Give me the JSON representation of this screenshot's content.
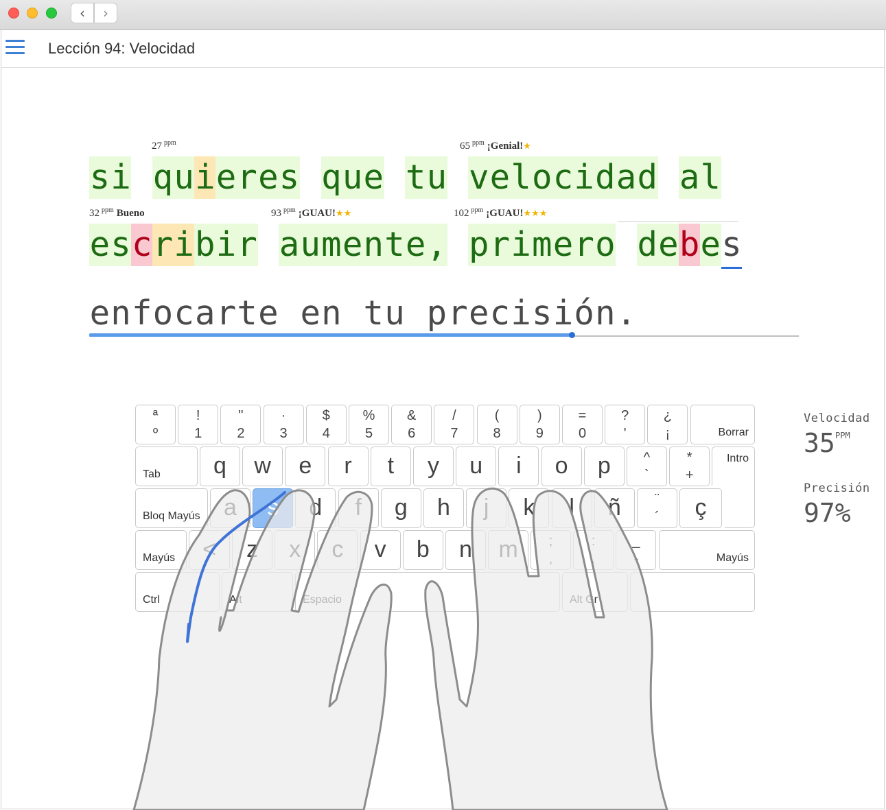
{
  "window": {
    "back_icon": "chevron-left-icon",
    "forward_icon": "chevron-right-icon"
  },
  "header": {
    "menu_icon": "hamburger-menu-icon",
    "title": "Lección 94: Velocidad"
  },
  "text": {
    "line1": "si quieres que tu velocidad al",
    "line2": "escribir aumente, primero debes",
    "line3": "enfocarte en tu precisión."
  },
  "word_labels": [
    {
      "num": "27",
      "unit": "ppm",
      "rating": "",
      "stars": ""
    },
    {
      "num": "65",
      "unit": "ppm",
      "rating": "¡Genial!",
      "stars": "★"
    },
    {
      "num": "32",
      "unit": "ppm",
      "rating": "Bueno",
      "stars": ""
    },
    {
      "num": "93",
      "unit": "ppm",
      "rating": "¡GUAU!",
      "stars": "★★"
    },
    {
      "num": "102",
      "unit": "ppm",
      "rating": "¡GUAU!",
      "stars": "★★★"
    }
  ],
  "progress": {
    "fraction": 0.68
  },
  "keyboard": {
    "row1": [
      {
        "up": "ª",
        "down": "º"
      },
      {
        "up": "!",
        "down": "1"
      },
      {
        "up": "\"",
        "down": "2"
      },
      {
        "up": "·",
        "down": "3"
      },
      {
        "up": "$",
        "down": "4"
      },
      {
        "up": "%",
        "down": "5"
      },
      {
        "up": "&",
        "down": "6"
      },
      {
        "up": "/",
        "down": "7"
      },
      {
        "up": "(",
        "down": "8"
      },
      {
        "up": ")",
        "down": "9"
      },
      {
        "up": "=",
        "down": "0"
      },
      {
        "up": "?",
        "down": "'"
      },
      {
        "up": "¿",
        "down": "¡"
      }
    ],
    "borrar": "Borrar",
    "tab": "Tab",
    "row2": [
      "q",
      "w",
      "e",
      "r",
      "t",
      "y",
      "u",
      "i",
      "o",
      "p"
    ],
    "row2_extra": [
      {
        "up": "^",
        "down": "`"
      },
      {
        "up": "*",
        "down": "+"
      }
    ],
    "intro": "Intro",
    "bloq": "Bloq Mayús",
    "row3": [
      "a",
      "s",
      "d",
      "f",
      "g",
      "h",
      "j",
      "k",
      "l",
      "ñ"
    ],
    "row3_extra": [
      {
        "up": "¨",
        "down": "´"
      }
    ],
    "cedilla": "ç",
    "mayus": "Mayús",
    "lt": "<",
    "row4": [
      "z",
      "x",
      "c",
      "v",
      "b",
      "n",
      "m"
    ],
    "row4_extra": [
      {
        "up": ";",
        "down": ","
      },
      {
        "up": ":",
        "down": "."
      },
      {
        "up": "_",
        "down": "-"
      }
    ],
    "mayus_r": "Mayús",
    "ctrl": "Ctrl",
    "alt": "Alt",
    "space": "Espacio",
    "altgr": "Alt Gr",
    "active_key": "s"
  },
  "stats": {
    "speed_label": "Velocidad",
    "speed_value": "35",
    "speed_unit": "PPM",
    "accuracy_label": "Precisión",
    "accuracy_value": "97%"
  }
}
